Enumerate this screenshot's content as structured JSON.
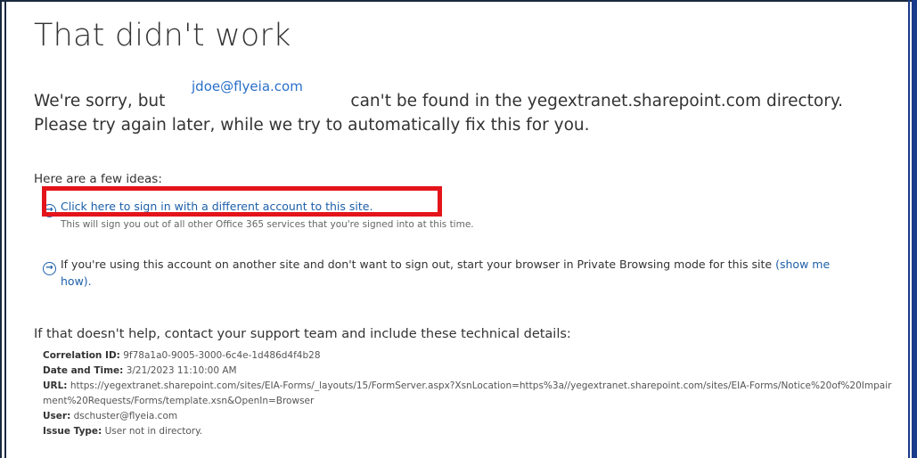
{
  "title": "That didn't work",
  "message": {
    "prefix": "We're sorry, but",
    "email": "jdoe@flyeia.com",
    "suffix": "can't be found in the yegextranet.sharepoint.com directory.",
    "line2": "Please try again later, while we try to automatically fix this for you."
  },
  "ideas_heading": "Here are a few ideas:",
  "idea1": {
    "link": "Click here to sign in with a different account to this site.",
    "sub": "This will sign you out of all other Office 365 services that you're signed into at this time."
  },
  "idea2": {
    "text": "If you're using this account on another site and don't want to sign out, start your browser in Private Browsing mode for this site",
    "link_part1": "(show me",
    "link_part2": "how)."
  },
  "help_text": "If that doesn't help, contact your support team and include these technical details:",
  "details": {
    "correlation_label": "Correlation ID:",
    "correlation_value": "9f78a1a0-9005-3000-6c4e-1d486d4f4b28",
    "datetime_label": "Date and Time:",
    "datetime_value": "3/21/2023 11:10:00 AM",
    "url_label": "URL:",
    "url_value": "https://yegextranet.sharepoint.com/sites/EIA-Forms/_layouts/15/FormServer.aspx?XsnLocation=https%3a//yegextranet.sharepoint.com/sites/EIA-Forms/Notice%20of%20Impairment%20Requests/Forms/template.xsn&OpenIn=Browser",
    "user_label": "User:",
    "user_value": "dschuster@flyeia.com",
    "issue_label": "Issue Type:",
    "issue_value": "User not in directory."
  },
  "colors": {
    "link": "#1d5fa9",
    "highlight": "#e4141b",
    "email": "#2a6fc9"
  }
}
